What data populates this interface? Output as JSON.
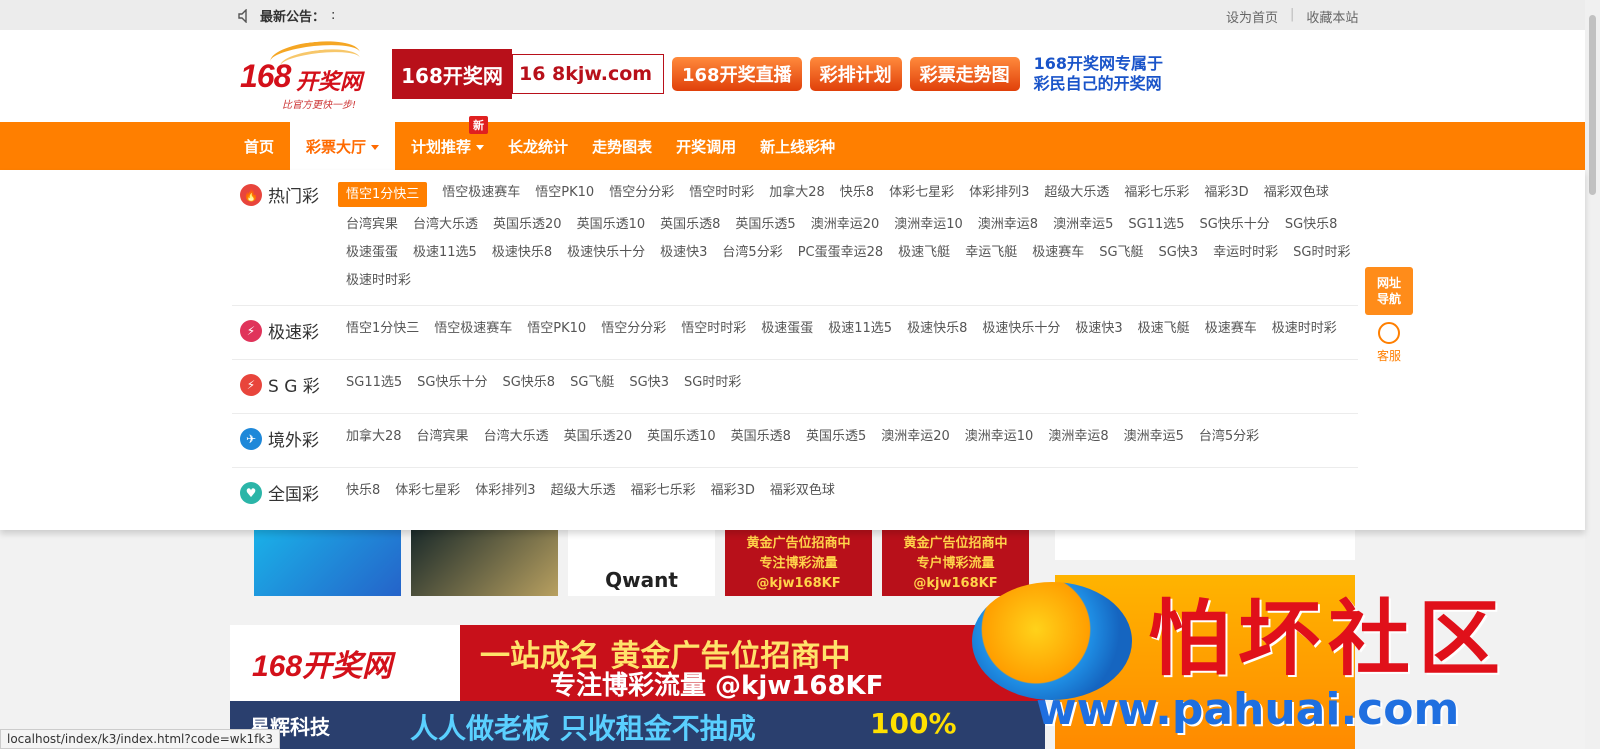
{
  "topbar": {
    "notice_label": "最新公告：",
    "notice_text": ":",
    "links": [
      "设为首页",
      "收藏本站"
    ]
  },
  "header": {
    "logo_num": "168",
    "logo_text": "开奖网",
    "logo_sub": "比官方更快一步!",
    "banner_site": "168开奖网",
    "banner_url": "16    8kjw.com",
    "banner_buttons": [
      "168开奖直播",
      "彩排计划",
      "彩票走势图"
    ],
    "slogan_line1": "168开奖网专属于",
    "slogan_line2": "彩民自己的开奖网"
  },
  "nav": {
    "items": [
      "首页",
      "彩票大厅",
      "计划推荐",
      "长龙统计",
      "走势图表",
      "开奖调用",
      "新上线彩种"
    ],
    "badge_new": "新"
  },
  "categories": [
    {
      "name": "热门彩",
      "color": "#e8453c",
      "games": [
        "悟空1分快三",
        "悟空极速赛车",
        "悟空PK10",
        "悟空分分彩",
        "悟空时时彩",
        "加拿大28",
        "快乐8",
        "体彩七星彩",
        "体彩排列3",
        "超级大乐透",
        "福彩七乐彩",
        "福彩3D",
        "福彩双色球",
        "台湾宾果",
        "台湾大乐透",
        "英国乐透20",
        "英国乐透10",
        "英国乐透8",
        "英国乐透5",
        "澳洲幸运20",
        "澳洲幸运10",
        "澳洲幸运8",
        "澳洲幸运5",
        "SG11选5",
        "SG快乐十分",
        "SG快乐8",
        "极速蛋蛋",
        "极速11选5",
        "极速快乐8",
        "极速快乐十分",
        "极速快3",
        "台湾5分彩",
        "PC蛋蛋幸运28",
        "极速飞艇",
        "幸运飞艇",
        "极速赛车",
        "SG飞艇",
        "SG快3",
        "幸运时时彩",
        "SG时时彩",
        "极速时时彩"
      ]
    },
    {
      "name": "极速彩",
      "color": "#e0335a",
      "games": [
        "悟空1分快三",
        "悟空极速赛车",
        "悟空PK10",
        "悟空分分彩",
        "悟空时时彩",
        "极速蛋蛋",
        "极速11选5",
        "极速快乐8",
        "极速快乐十分",
        "极速快3",
        "极速飞艇",
        "极速赛车",
        "极速时时彩"
      ]
    },
    {
      "name": "S G 彩",
      "color": "#e8453c",
      "games": [
        "SG11选5",
        "SG快乐十分",
        "SG快乐8",
        "SG飞艇",
        "SG快3",
        "SG时时彩"
      ]
    },
    {
      "name": "境外彩",
      "color": "#1e88d9",
      "games": [
        "加拿大28",
        "台湾宾果",
        "台湾大乐透",
        "英国乐透20",
        "英国乐透10",
        "英国乐透8",
        "英国乐透5",
        "澳洲幸运20",
        "澳洲幸运10",
        "澳洲幸运8",
        "澳洲幸运5",
        "台湾5分彩"
      ]
    },
    {
      "name": "全国彩",
      "color": "#2bb5a8",
      "games": [
        "快乐8",
        "体彩七星彩",
        "体彩排列3",
        "超级大乐透",
        "福彩七乐彩",
        "福彩3D",
        "福彩双色球"
      ]
    }
  ],
  "float": {
    "nav_line1": "网址",
    "nav_line2": "导航",
    "kf_label": "客服"
  },
  "ads": {
    "thumb3": "Qwant",
    "thumb4_l1": "黄金广告位招商中",
    "thumb4_l2": "专注博彩流量",
    "thumb4_l3": "@kjw168KF",
    "thumb5_l1": "黄金广告位招商中",
    "thumb5_l2": "专户博彩流量",
    "thumb5_l3": "@kjw168KF",
    "big_logo": "168开奖网",
    "big_l1": "一站成名 黄金广告位招商中",
    "big_l2": "专注博彩流量 @kjw168KF",
    "ad2_brand": "星辉科技",
    "ad2_text": "人人做老板 只收租金不抽成",
    "ad2_pct": "100%"
  },
  "watermark": {
    "title": "怕坏社区",
    "url": "www.pahuai.com"
  },
  "statusbar": {
    "url": "localhost/index/k3/index.html?code=wk1fk3"
  }
}
